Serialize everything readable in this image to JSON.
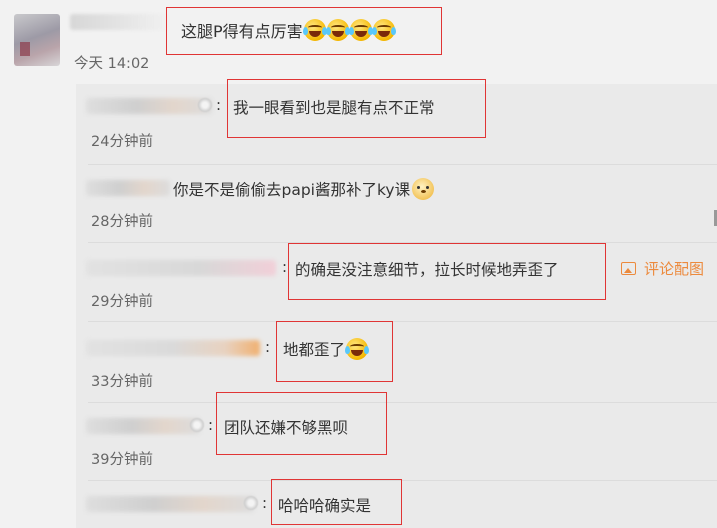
{
  "post": {
    "text": "这腿P得有点厉害",
    "emoji_icon": "laughing-crying-emoji",
    "emoji_count": 4,
    "time": "今天 14:02"
  },
  "comments": [
    {
      "colon": ":",
      "text": "我一眼看到也是腿有点不正常",
      "time": "24分钟前"
    },
    {
      "colon": "",
      "text": "你是不是偷偷去papi酱那补了ky课",
      "emoji_icon": "dog-emoji",
      "time": "28分钟前"
    },
    {
      "colon": ":",
      "text": "的确是没注意细节，拉长时候地弄歪了",
      "picture_link": "评论配图",
      "time": "29分钟前"
    },
    {
      "colon": ":",
      "text": "地都歪了",
      "emoji_icon": "laughing-crying-emoji",
      "time": "33分钟前"
    },
    {
      "colon": ":",
      "text": "团队还嫌不够黑呗",
      "time": "39分钟前"
    },
    {
      "colon": ":",
      "text": "哈哈哈确实是",
      "time": ""
    }
  ],
  "colors": {
    "highlight_border": "#e03535",
    "link": "#ec8a3d",
    "background": "#f2f2f2"
  }
}
